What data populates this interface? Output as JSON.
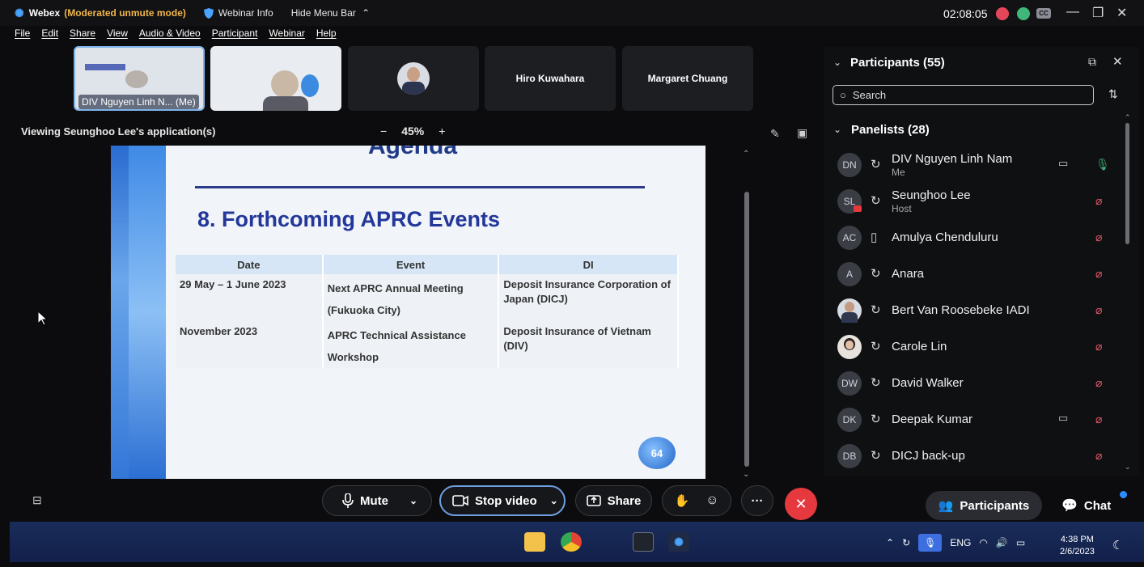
{
  "titlebar": {
    "app_name": "Webex",
    "mode": "(Moderated unmute mode)",
    "webinar_info": "Webinar Info",
    "hide_menu": "Hide Menu Bar",
    "clock": "02:08:05",
    "cc_label": "CC"
  },
  "menu": [
    "File",
    "Edit",
    "Share",
    "View",
    "Audio & Video",
    "Participant",
    "Webinar",
    "Help"
  ],
  "thumbnails": {
    "self_name": "DIV Nguyen Linh N... (Me)",
    "t4": "Hiro Kuwahara",
    "t5": "Margaret Chuang"
  },
  "viewing": {
    "label": "Viewing Seunghoo Lee's application(s)",
    "zoom": "45%",
    "minus": "−",
    "plus": "+"
  },
  "slide": {
    "agenda": "Agenda",
    "heading": "8.  Forthcoming APRC Events",
    "headers": [
      "Date",
      "Event",
      "DI"
    ],
    "rows": [
      {
        "date": "29 May – 1 June 2023",
        "event": "Next APRC Annual Meeting (Fukuoka City)",
        "di": "Deposit Insurance Corporation of Japan (DICJ)"
      },
      {
        "date": "November 2023",
        "event": "APRC Technical Assistance Workshop",
        "di": "Deposit Insurance of Vietnam (DIV)"
      }
    ],
    "page_number": "64"
  },
  "toolbar": {
    "mute": "Mute",
    "stop_video": "Stop video",
    "share": "Share"
  },
  "panel": {
    "title": "Participants (55)",
    "search_placeholder": "Search",
    "panelists_title": "Panelists (28)",
    "participants": [
      {
        "initials": "DN",
        "name": "DIV Nguyen Linh Nam",
        "role": "Me"
      },
      {
        "initials": "SL",
        "name": "Seunghoo Lee",
        "role": "Host"
      },
      {
        "initials": "AC",
        "name": "Amulya Chenduluru",
        "role": ""
      },
      {
        "initials": "A",
        "name": "Anara",
        "role": ""
      },
      {
        "initials": "",
        "name": "Bert Van Roosebeke IADI",
        "role": ""
      },
      {
        "initials": "",
        "name": "Carole Lin",
        "role": ""
      },
      {
        "initials": "DW",
        "name": "David Walker",
        "role": ""
      },
      {
        "initials": "DK",
        "name": "Deepak Kumar",
        "role": ""
      },
      {
        "initials": "DB",
        "name": "DICJ back-up",
        "role": ""
      }
    ]
  },
  "bottom": {
    "participants_btn": "Participants",
    "chat_btn": "Chat"
  },
  "taskbar": {
    "lang": "ENG",
    "time": "4:38 PM",
    "date": "2/6/2023"
  },
  "colors": {
    "accent_blue": "#4aa3ff",
    "mode_orange": "#f0b64a",
    "leave_red": "#e5393f",
    "muted_red": "#e35a6a"
  }
}
